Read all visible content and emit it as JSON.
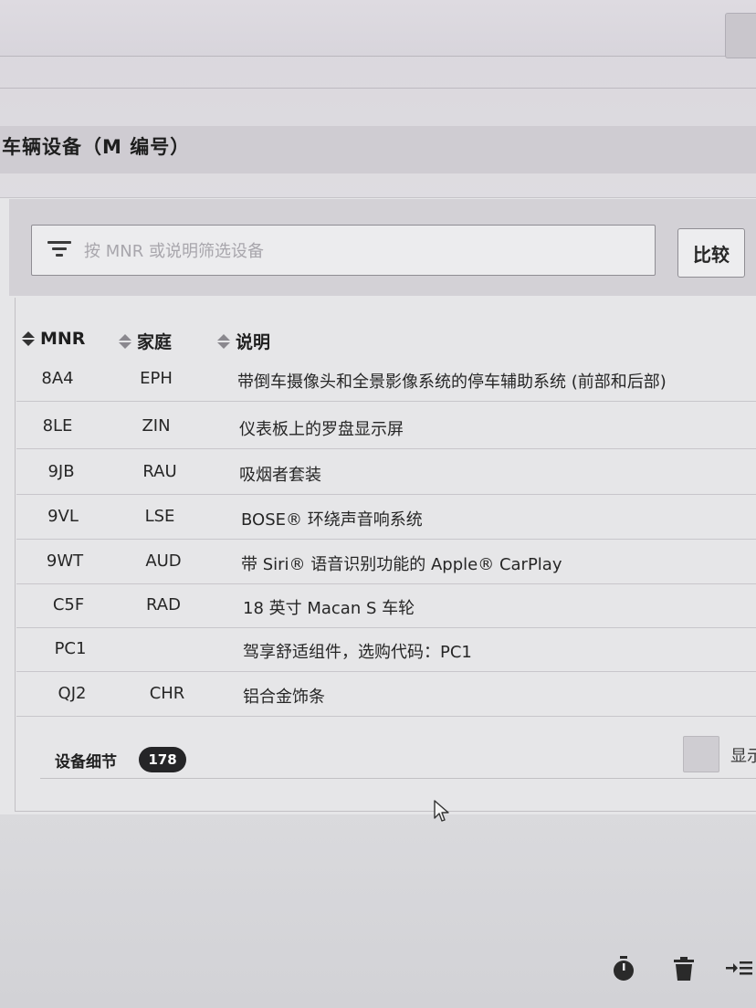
{
  "section": {
    "title": "车辆设备（M 编号）"
  },
  "filter": {
    "placeholder": "按 MNR 或说明筛选设备"
  },
  "compare_button": "比较",
  "table": {
    "columns": [
      "MNR",
      "家庭",
      "说明"
    ],
    "rows": [
      {
        "mnr": "8A4",
        "family": "EPH",
        "description": "带倒车摄像头和全景影像系统的停车辅助系统 (前部和后部)"
      },
      {
        "mnr": "8LE",
        "family": "ZIN",
        "description": "仪表板上的罗盘显示屏"
      },
      {
        "mnr": "9JB",
        "family": "RAU",
        "description": "吸烟者套装"
      },
      {
        "mnr": "9VL",
        "family": "LSE",
        "description": "BOSE® 环绕声音响系统"
      },
      {
        "mnr": "9WT",
        "family": "AUD",
        "description": "带 Siri® 语音识别功能的 Apple® CarPlay"
      },
      {
        "mnr": "C5F",
        "family": "RAD",
        "description": "18 英寸 Macan S 车轮"
      },
      {
        "mnr": "PC1",
        "family": "",
        "description": "驾享舒适组件，选购代码：PC1"
      },
      {
        "mnr": "QJ2",
        "family": "CHR",
        "description": "铝合金饰条"
      }
    ]
  },
  "footer": {
    "label": "设备细节",
    "count": "178",
    "show_label": "显示"
  },
  "icons": [
    "filter-icon",
    "sort-icon",
    "timer-icon",
    "trash-icon",
    "indent-icon",
    "cursor-icon"
  ],
  "colors": {
    "badge_bg": "#252527",
    "panel_bg": "#e6e6e8",
    "header_bg": "#cfccd2"
  }
}
